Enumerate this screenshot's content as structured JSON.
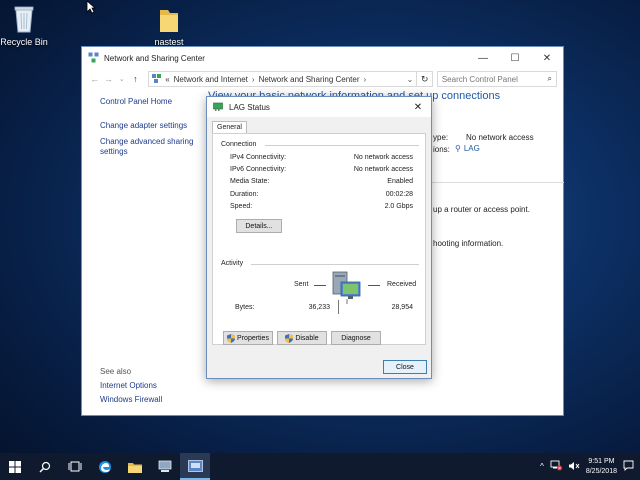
{
  "desktop": {
    "icons": [
      {
        "label": "Recycle Bin",
        "icon": "recycle-bin-icon"
      },
      {
        "label": "nastest",
        "icon": "folder-icon"
      }
    ]
  },
  "main_window": {
    "title": "Network and Sharing Center",
    "breadcrumb": {
      "prefix": "«",
      "items": [
        "Network and Internet",
        "Network and Sharing Center"
      ]
    },
    "search_placeholder": "Search Control Panel",
    "left_pane": {
      "home": "Control Panel Home",
      "links": [
        "Change adapter settings",
        "Change advanced sharing settings"
      ]
    },
    "see_also": {
      "heading": "See also",
      "links": [
        "Internet Options",
        "Windows Firewall"
      ]
    },
    "heading_visible": "View your basic network information and set up connections",
    "access_type_label": "ype:",
    "access_type_value": "No network access",
    "connections_label": "ions:",
    "connections_value": "LAG",
    "partial_line_1": "up a router or access point.",
    "partial_line_2": "hooting information."
  },
  "dialog": {
    "title": "LAG Status",
    "tab": "General",
    "connection": {
      "heading": "Connection",
      "rows": [
        {
          "label": "IPv4 Connectivity:",
          "value": "No network access"
        },
        {
          "label": "IPv6 Connectivity:",
          "value": "No network access"
        },
        {
          "label": "Media State:",
          "value": "Enabled"
        },
        {
          "label": "Duration:",
          "value": "00:02:28"
        },
        {
          "label": "Speed:",
          "value": "2.0 Gbps"
        }
      ],
      "details_button": "Details..."
    },
    "activity": {
      "heading": "Activity",
      "sent_label": "Sent",
      "received_label": "Received",
      "bytes_label": "Bytes:",
      "bytes_sent": "36,233",
      "bytes_received": "28,954"
    },
    "buttons": {
      "properties": "Properties",
      "disable": "Disable",
      "diagnose": "Diagnose",
      "close": "Close"
    }
  },
  "taskbar": {
    "time": "9:51 PM",
    "date": "8/25/2018"
  },
  "colors": {
    "link": "#1e3c8c",
    "heading_blue": "#1e5aa8",
    "taskbar": "#0f1a2e"
  }
}
